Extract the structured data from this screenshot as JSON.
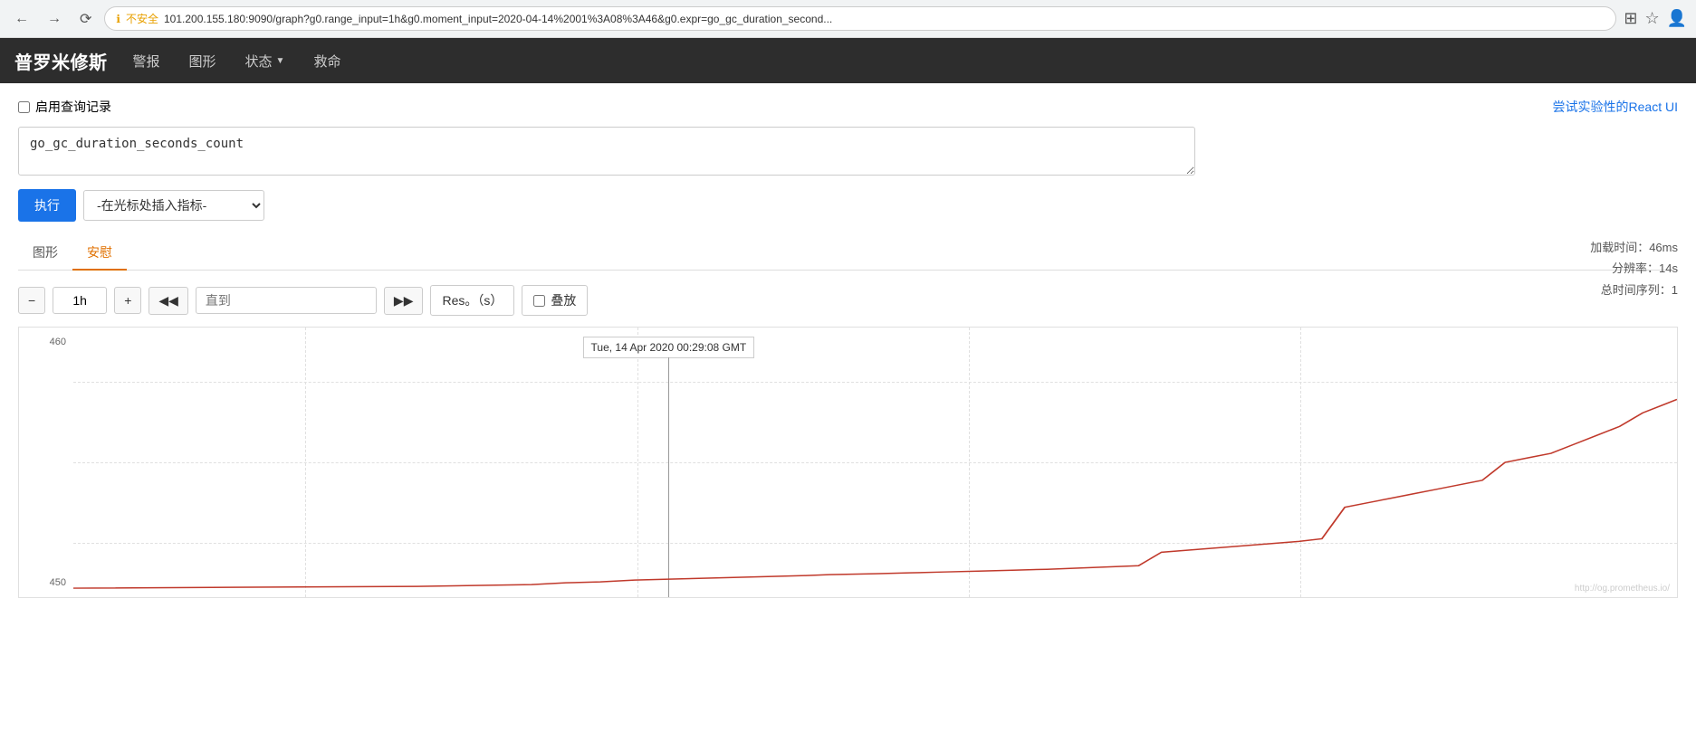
{
  "browser": {
    "url": "101.200.155.180:9090/graph?g0.range_input=1h&g0.moment_input=2020-04-14%2001%3A08%3A46&g0.expr=go_gc_duration_second...",
    "security_label": "不安全",
    "back_title": "后退",
    "forward_title": "前进",
    "refresh_title": "刷新"
  },
  "navbar": {
    "brand": "普罗米修斯",
    "nav_items": [
      {
        "label": "警报",
        "has_dropdown": false
      },
      {
        "label": "图形",
        "has_dropdown": false
      },
      {
        "label": "状态",
        "has_dropdown": true
      },
      {
        "label": "救命",
        "has_dropdown": false
      }
    ]
  },
  "main": {
    "query_record_label": "启用查询记录",
    "react_ui_link": "尝试实验性的React UI",
    "query_value": "go_gc_duration_seconds_count",
    "execute_btn": "执行",
    "metric_placeholder": "-在光标处插入指标-",
    "info": {
      "load_time_label": "加载时间：46ms",
      "resolution_label": "分辨率：14s",
      "total_series_label": "总时间序列：1"
    },
    "tabs": [
      {
        "label": "图形",
        "active": false
      },
      {
        "label": "安慰",
        "active": true
      }
    ],
    "graph_controls": {
      "decrease_btn": "−",
      "time_range_value": "1h",
      "increase_btn": "+",
      "back_btn": "◀◀",
      "end_time_placeholder": "直到",
      "forward_btn": "▶▶",
      "resolution_btn": "Res。（s）",
      "stack_btn": "叠放",
      "stack_checkbox": false
    },
    "chart": {
      "tooltip": "Tue, 14 Apr 2020 00:29:08 GMT",
      "tooltip_line_x_pct": 34,
      "y_labels": [
        "460",
        "",
        "450"
      ],
      "y_460_pct": 20,
      "y_450_pct": 80,
      "watermark": "http://og.prometheus.io/",
      "data_color": "#c0392b"
    }
  }
}
